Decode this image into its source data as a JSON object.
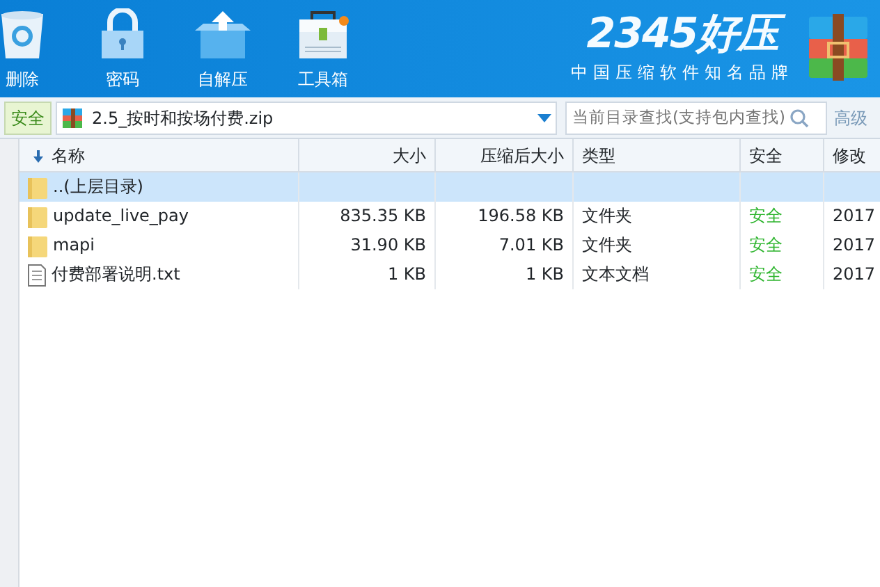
{
  "toolbar": [
    {
      "label": "删除",
      "kind": "trash"
    },
    {
      "label": "密码",
      "kind": "lock"
    },
    {
      "label": "自解压",
      "kind": "box"
    },
    {
      "label": "工具箱",
      "kind": "toolbox"
    }
  ],
  "logo": {
    "title": "2345好压",
    "tagline": "中国压缩软件知名品牌"
  },
  "address_bar": {
    "safety": "安全",
    "path": "2.5_按时和按场付费.zip",
    "search_placeholder": "当前目录查找(支持包内查找)",
    "advanced": "高级"
  },
  "table": {
    "columns": [
      "名称",
      "大小",
      "压缩后大小",
      "类型",
      "安全",
      "修改"
    ],
    "rows": [
      {
        "kind": "parent",
        "name": "..(上层目录)",
        "selected": true
      },
      {
        "kind": "folder",
        "name": "update_live_pay",
        "size": "835.35 KB",
        "packed": "196.58 KB",
        "type": "文件夹",
        "safety": "安全",
        "modified": "2017",
        "selected": false
      },
      {
        "kind": "folder",
        "name": "mapi",
        "size": "31.90 KB",
        "packed": "7.01 KB",
        "type": "文件夹",
        "safety": "安全",
        "modified": "2017",
        "selected": false
      },
      {
        "kind": "file",
        "name": "付费部署说明.txt",
        "size": "1 KB",
        "packed": "1 KB",
        "type": "文本文档",
        "safety": "安全",
        "modified": "2017",
        "selected": false
      }
    ]
  }
}
